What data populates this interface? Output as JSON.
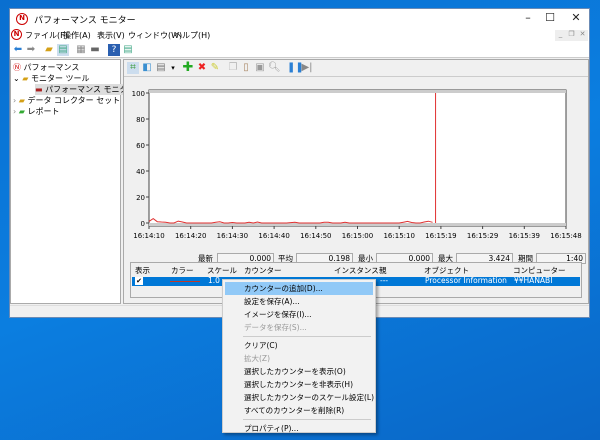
{
  "window": {
    "title": "パフォーマンス モニター",
    "minimize_icon": "minimize-icon",
    "maximize_icon": "maximize-icon",
    "close_icon": "close-icon"
  },
  "menubar": {
    "items": [
      "ファイル(F)",
      "操作(A)",
      "表示(V)",
      "ウィンドウ(W)",
      "ヘルプ(H)"
    ]
  },
  "tree": {
    "items": [
      {
        "label": "パフォーマンス",
        "level": 0
      },
      {
        "label": "モニター ツール",
        "level": 1,
        "expanded": true
      },
      {
        "label": "パフォーマンス モニター",
        "level": 2,
        "selected": true
      },
      {
        "label": "データ コレクター セット",
        "level": 1
      },
      {
        "label": "レポート",
        "level": 1
      }
    ]
  },
  "stats": {
    "last_label": "最新",
    "last": "0.000",
    "avg_label": "平均",
    "avg": "0.198",
    "min_label": "最小",
    "min": "0.000",
    "max_label": "最大",
    "max": "3.424",
    "duration_label": "期間",
    "duration": "1:40"
  },
  "table": {
    "headers": [
      "表示",
      "カラー",
      "スケール",
      "カウンター",
      "インスタンス",
      "親",
      "オブジェクト",
      "コンピューター"
    ],
    "row": {
      "checked": true,
      "color": "#c0392b",
      "scale": "1.0",
      "counter": "",
      "instance": "",
      "parent": "---",
      "object": "Processor Information",
      "computer": "¥¥HANABI"
    }
  },
  "context_menu": {
    "items": [
      {
        "label": "カウンターの追加(D)...",
        "highlighted": true
      },
      {
        "label": "設定を保存(A)..."
      },
      {
        "label": "イメージを保存(I)..."
      },
      {
        "label": "データを保存(S)...",
        "disabled": true
      },
      {
        "sep": true
      },
      {
        "label": "クリア(C)"
      },
      {
        "label": "拡大(Z)",
        "disabled": true
      },
      {
        "label": "選択したカウンターを表示(O)"
      },
      {
        "label": "選択したカウンターを非表示(H)"
      },
      {
        "label": "選択したカウンターのスケール設定(L)"
      },
      {
        "label": "すべてのカウンターを削除(R)"
      },
      {
        "sep": true
      },
      {
        "label": "プロパティ(P)..."
      }
    ]
  },
  "chart_data": {
    "type": "line",
    "ylim": [
      0,
      100
    ],
    "yticks": [
      "100",
      "80",
      "60",
      "40",
      "20",
      "0"
    ],
    "xticks": [
      "16:14:10",
      "16:14:20",
      "16:14:30",
      "16:14:40",
      "16:14:50",
      "16:15:00",
      "16:15:10",
      "16:15:19",
      "16:15:29",
      "16:15:39",
      "16:15:48"
    ],
    "series": [
      {
        "color": "#e03030",
        "values": [
          1.2,
          3.4,
          1.0,
          0.8,
          0.6,
          0,
          0,
          1.5,
          0.8,
          0,
          0,
          0,
          0,
          0,
          0,
          0,
          0.5,
          0.9,
          0,
          0,
          0.4,
          0,
          0,
          0,
          0.6,
          0,
          0.8,
          0,
          0,
          0,
          0,
          0,
          0,
          0,
          0.3,
          0.6,
          0,
          0,
          0,
          0,
          0,
          0,
          0.5,
          0.6,
          0,
          0,
          0,
          0.5,
          0,
          0,
          0,
          0,
          0,
          0,
          0,
          0,
          0,
          0,
          0,
          0,
          0,
          0.6,
          1.2,
          0.4,
          0,
          0,
          0.8,
          1.4,
          0.5
        ]
      }
    ],
    "cursor_time": "16:15:19",
    "grid": false
  }
}
